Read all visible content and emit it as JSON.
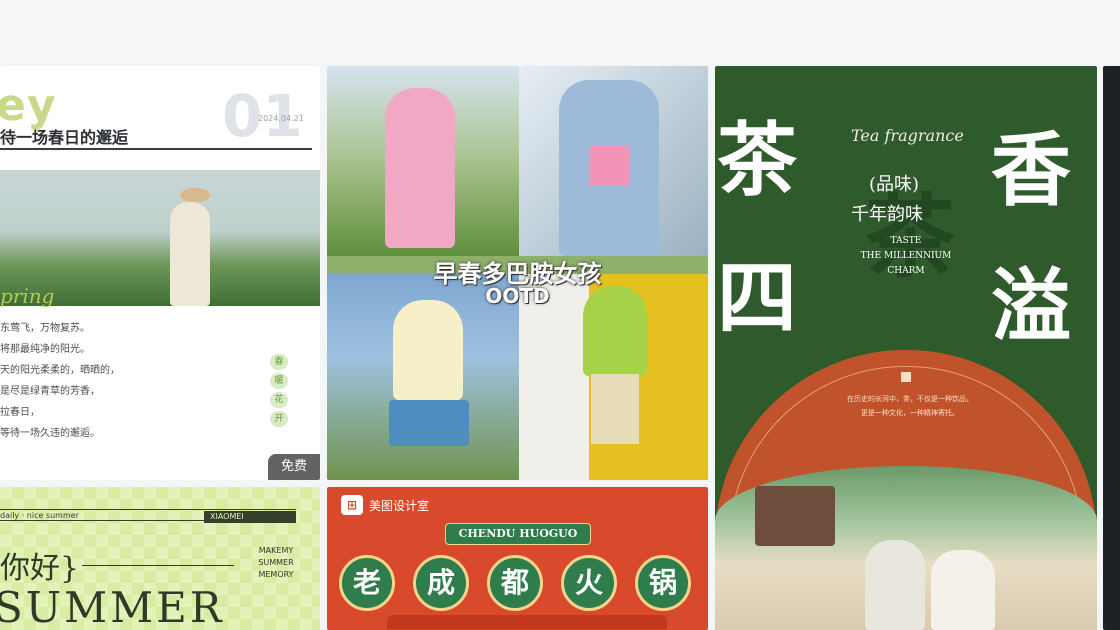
{
  "card1": {
    "hey": "ey",
    "number": "01",
    "date": "2024.04.21",
    "title": "待一场春日的邂逅",
    "spring": "pring",
    "lines": [
      "东莺飞，万物复苏。",
      "将那最纯净的阳光。",
      "天的阳光柔柔的，晒晒的，",
      "是尽是绿青草的芳香，",
      "拉春日，",
      "等待一场久违的邂逅。"
    ],
    "tags": [
      "春",
      "暖",
      "花",
      "开"
    ],
    "badge": "免费"
  },
  "card2": {
    "headline": "早春多巴胺女孩",
    "sub": "OOTD"
  },
  "card3": {
    "big_left_top": "茶",
    "big_left_bottom": "四",
    "big_right_top": "香",
    "big_right_bottom": "溢",
    "en_title": "Tea fragrance",
    "pin": "(品味)",
    "qiannian": "千年韵味",
    "en_lines": [
      "TASTE",
      "THE MILLENNIUM",
      "CHARM"
    ],
    "ghost": "茶",
    "body": [
      "在历史的长河中，茶，不仅是一种饮品，",
      "更是一种文化，一种精神寄托。"
    ]
  },
  "card5": {
    "hello": "daily · nice summer",
    "brand": "XIAOMEI",
    "greet": "你好}",
    "side": [
      "MAKEMY",
      "SUMMER",
      "MEMORY"
    ],
    "big": "SUMMER"
  },
  "card6": {
    "brand": "美图设计室",
    "ribbon": "CHENDU HUOGUO",
    "chars": [
      "老",
      "成",
      "都",
      "火",
      "锅"
    ]
  },
  "colors": {
    "tea_green": "#2f5a2c",
    "hotpot_red": "#d94a2c",
    "summer_green": "#e3f2b8"
  }
}
